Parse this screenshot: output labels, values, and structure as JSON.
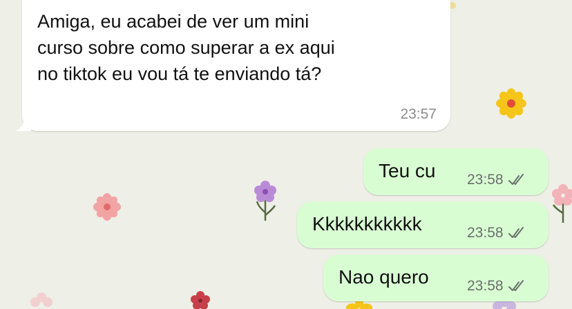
{
  "chat": {
    "incoming": [
      {
        "lines": [
          "Amiga, eu acabei de ver um mini",
          "curso sobre como superar a ex aqui",
          "no tiktok eu vou tá te enviando tá?"
        ],
        "time": "23:57"
      }
    ],
    "outgoing": [
      {
        "text": "Teu cu",
        "time": "23:58",
        "status": "read"
      },
      {
        "text": "Kkkkkkkkkkk",
        "time": "23:58",
        "status": "read"
      },
      {
        "text": "Nao quero",
        "time": "23:58",
        "status": "read"
      }
    ]
  },
  "colors": {
    "background": "#eeefe6",
    "incoming_bubble": "#ffffff",
    "outgoing_bubble": "#d9fdd3",
    "read_ticks": "#68706a"
  },
  "icons": [
    "double-check-icon",
    "flower-doodle-icon"
  ]
}
